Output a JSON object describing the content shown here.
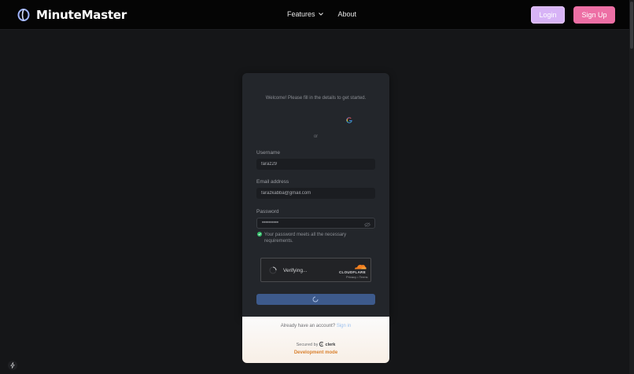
{
  "header": {
    "brand_name": "MinuteMaster",
    "nav": {
      "features_label": "Features",
      "about_label": "About"
    },
    "login_label": "Login",
    "signup_label": "Sign Up"
  },
  "signup_card": {
    "welcome_text": "Welcome! Please fill in the details to get started.",
    "divider_text": "or",
    "username": {
      "label": "Username",
      "value": "faraz29"
    },
    "email": {
      "label": "Email address",
      "value": "farazkabba@gmail.com"
    },
    "password": {
      "label": "Password",
      "value": "••••••••••",
      "validation_text": "Your password meets all the necessary requirements."
    },
    "captcha": {
      "status_text": "Verifying...",
      "provider_name": "CLOUDFLARE",
      "links_text": "Privacy • Terms"
    }
  },
  "card_footer": {
    "have_account_text": "Already have an account?",
    "signin_link": "Sign in",
    "secured_by_text": "Secured by",
    "provider": "clerk",
    "dev_mode_text": "Development mode"
  },
  "icons": {
    "brand_logo": "minutemaster-logo-icon",
    "features_chevron": "chevron-down-icon",
    "google": "google-icon",
    "password_visibility": "eye-off-icon",
    "validation": "check-circle-icon",
    "loading": "spinner-icon",
    "corner_badge": "lightning-icon"
  },
  "colors": {
    "login_button": "#d7b3f6",
    "signup_button": "#ed6fa5",
    "submit_button": "#3d5a8c",
    "dev_mode": "#d9812f",
    "cloudflare_orange": "#f38020"
  }
}
